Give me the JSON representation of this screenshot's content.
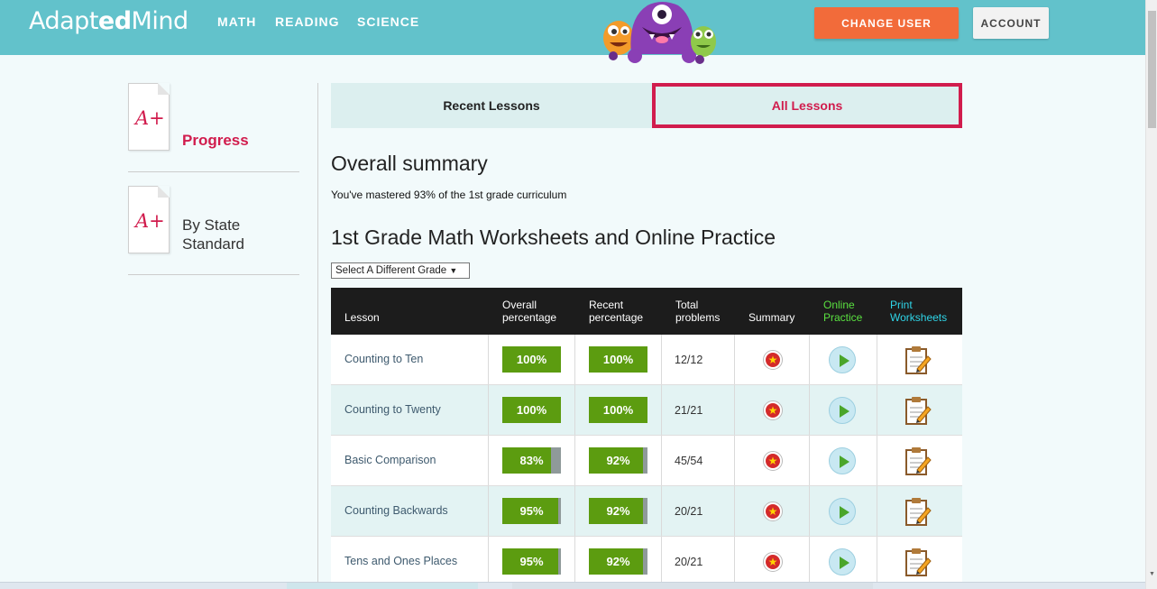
{
  "header": {
    "logo_prefix": "Adapt",
    "logo_bold": "ed",
    "logo_suffix": "Mind",
    "nav": [
      "MATH",
      "READING",
      "SCIENCE"
    ],
    "change_user": "CHANGE USER",
    "account": "ACCOUNT"
  },
  "sidebar": {
    "items": [
      {
        "icon_text": "A+",
        "label": "Progress",
        "active": true
      },
      {
        "icon_text": "A+",
        "label_line1": "By State",
        "label_line2": "Standard",
        "active": false
      }
    ]
  },
  "tabs": {
    "recent": "Recent Lessons",
    "all": "All Lessons",
    "selected": "All Lessons"
  },
  "summary": {
    "heading": "Overall summary",
    "mastered_text": "You've mastered 93% of the 1st grade curriculum"
  },
  "grade": {
    "heading": "1st Grade Math Worksheets and Online Practice",
    "select_label": "Select A Different Grade",
    "select_arrow": "▼"
  },
  "table": {
    "headers": {
      "lesson": "Lesson",
      "overall_1": "Overall",
      "overall_2": "percentage",
      "recent_1": "Recent",
      "recent_2": "percentage",
      "total_1": "Total",
      "total_2": "problems",
      "summary": "Summary",
      "online_1": "Online",
      "online_2": "Practice",
      "print_1": "Print",
      "print_2": "Worksheets"
    },
    "rows": [
      {
        "lesson": "Counting to Ten",
        "overall": "100%",
        "overall_value": 100,
        "recent": "100%",
        "recent_value": 100,
        "total": "12/12"
      },
      {
        "lesson": "Counting to Twenty",
        "overall": "100%",
        "overall_value": 100,
        "recent": "100%",
        "recent_value": 100,
        "total": "21/21"
      },
      {
        "lesson": "Basic Comparison",
        "overall": "83%",
        "overall_value": 83,
        "recent": "92%",
        "recent_value": 92,
        "total": "45/54"
      },
      {
        "lesson": "Counting Backwards",
        "overall": "95%",
        "overall_value": 95,
        "recent": "92%",
        "recent_value": 92,
        "total": "20/21"
      },
      {
        "lesson": "Tens and Ones Places",
        "overall": "95%",
        "overall_value": 95,
        "recent": "92%",
        "recent_value": 92,
        "total": "20/21"
      }
    ],
    "icons": {
      "summary": "star-badge-icon",
      "online": "play-icon",
      "print": "worksheet-pencil-icon"
    }
  },
  "colors": {
    "header_bg": "#62c2cb",
    "accent_orange": "#f26b3a",
    "accent_red": "#d11c4d",
    "progress_green": "#5c9c10",
    "online_green": "#5ae040",
    "print_cyan": "#2fd5e8"
  }
}
